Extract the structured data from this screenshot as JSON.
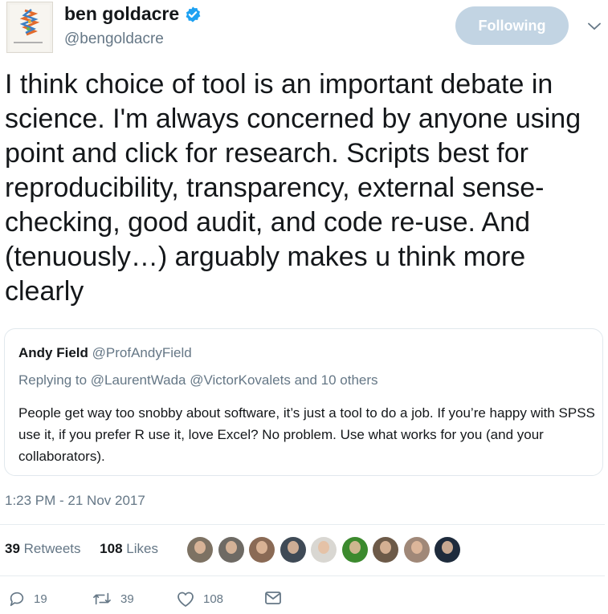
{
  "user": {
    "name": "ben goldacre",
    "handle": "@bengoldacre",
    "follow_label": "Following",
    "verified_icon": "verified-badge-icon"
  },
  "tweet": {
    "text": "I think choice of tool is an important debate in science. I'm always concerned by anyone using point and click for research. Scripts best for reproducibility, transparency, external sense-checking, good audit, and code re-use. And (tenuously…) arguably makes u think more clearly",
    "timestamp": "1:23 PM - 21 Nov 2017"
  },
  "quoted_tweet": {
    "author_name": "Andy Field",
    "author_handle": "@ProfAndyField",
    "reply_prefix": "Replying to",
    "reply_mention_1": "@LaurentWada",
    "reply_mention_2": "@VictorKovalets",
    "reply_suffix": "and 10 others",
    "text": "People get way too snobby about software, it’s just a tool to do a job. If you’re happy with SPSS use it, if you prefer R use it, love Excel? No problem. Use what works for you (and your collaborators)."
  },
  "stats": {
    "retweets_count": "39",
    "retweets_label": "Retweets",
    "likes_count": "108",
    "likes_label": "Likes"
  },
  "likers": [
    {
      "color": "#7d7263"
    },
    {
      "color": "#6e6a64"
    },
    {
      "color": "#8a6a55"
    },
    {
      "color": "#3f4a56"
    },
    {
      "color": "#d9d7d2"
    },
    {
      "color": "#3c8a2e"
    },
    {
      "color": "#6d5a48"
    },
    {
      "color": "#a08878"
    },
    {
      "color": "#1e2b3c"
    }
  ],
  "actions": {
    "reply_count": "19",
    "retweet_count": "39",
    "like_count": "108"
  },
  "colors": {
    "accent": "#1da1f2",
    "follow_button": "#c2d4e3",
    "secondary_text": "#657786"
  }
}
